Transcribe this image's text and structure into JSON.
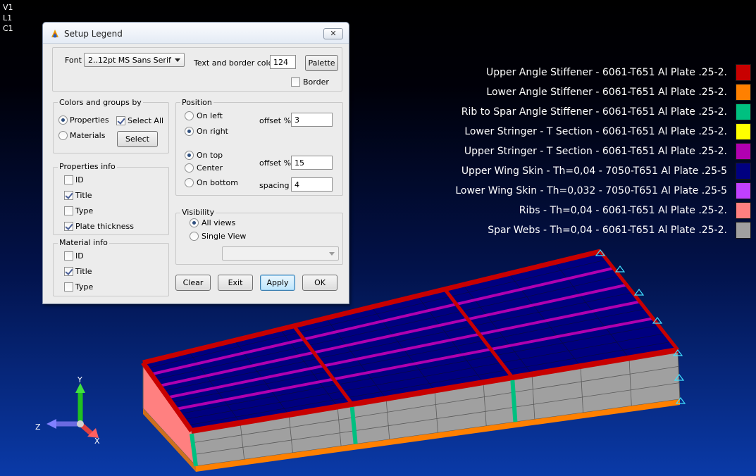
{
  "view_indicators": [
    "V1",
    "L1",
    "C1"
  ],
  "legend": {
    "items": [
      {
        "label": "Upper Angle Stiffener - 6061-T651 Al Plate .25-2.",
        "color": "#c80000"
      },
      {
        "label": "Lower Angle Stiffener - 6061-T651 Al Plate .25-2.",
        "color": "#ff8000"
      },
      {
        "label": "Rib to Spar Angle Stiffener - 6061-T651 Al Plate .25-2.",
        "color": "#00c080"
      },
      {
        "label": "Lower Stringer - T Section - 6061-T651 Al Plate .25-2.",
        "color": "#ffff00"
      },
      {
        "label": "Upper Stringer - T Section - 6061-T651 Al Plate .25-2.",
        "color": "#b000b0"
      },
      {
        "label": "Upper Wing Skin - Th=0,04 - 7050-T651 Al Plate .25-5",
        "color": "#000080"
      },
      {
        "label": "Lower Wing Skin - Th=0,032 - 7050-T651 Al Plate .25-5",
        "color": "#c040ff"
      },
      {
        "label": "Ribs - Th=0,04 - 6061-T651 Al Plate .25-2.",
        "color": "#ff8080"
      },
      {
        "label": "Spar Webs - Th=0,04 - 6061-T651 Al Plate .25-2.",
        "color": "#a0a0a0"
      }
    ]
  },
  "axes": {
    "y": "Y",
    "z": "Z",
    "x": "X"
  },
  "dialog": {
    "title": "Setup Legend",
    "close_label": "✕",
    "font_label": "Font",
    "font_value": "2..12pt MS Sans Serif",
    "text_border_color_label": "Text and border color",
    "text_border_color_value": "124",
    "palette_label": "Palette",
    "border_label": "Border",
    "border_checked": false,
    "colors_groups": {
      "title": "Colors and groups by",
      "properties_label": "Properties",
      "materials_label": "Materials",
      "selected": "Properties",
      "select_all_label": "Select All",
      "select_all_checked": true,
      "select_button": "Select"
    },
    "properties_info": {
      "title": "Properties info",
      "items": [
        {
          "label": "ID",
          "checked": false
        },
        {
          "label": "Title",
          "checked": true
        },
        {
          "label": "Type",
          "checked": false
        },
        {
          "label": "Plate thickness",
          "checked": true
        }
      ]
    },
    "material_info": {
      "title": "Material info",
      "items": [
        {
          "label": "ID",
          "checked": false
        },
        {
          "label": "Title",
          "checked": true
        },
        {
          "label": "Type",
          "checked": false
        }
      ]
    },
    "position": {
      "title": "Position",
      "on_left": "On left",
      "on_right": "On right",
      "horizontal_selected": "On right",
      "offset_label": "offset %",
      "h_offset": "3",
      "on_top": "On top",
      "center": "Center",
      "on_bottom": "On bottom",
      "vertical_selected": "On top",
      "v_offset": "15",
      "spacing_label": "spacing",
      "spacing": "4"
    },
    "visibility": {
      "title": "Visibility",
      "all_views": "All views",
      "single_view": "Single View",
      "selected": "All views",
      "view_select_value": ""
    },
    "buttons": {
      "clear": "Clear",
      "exit": "Exit",
      "apply": "Apply",
      "ok": "OK"
    }
  }
}
